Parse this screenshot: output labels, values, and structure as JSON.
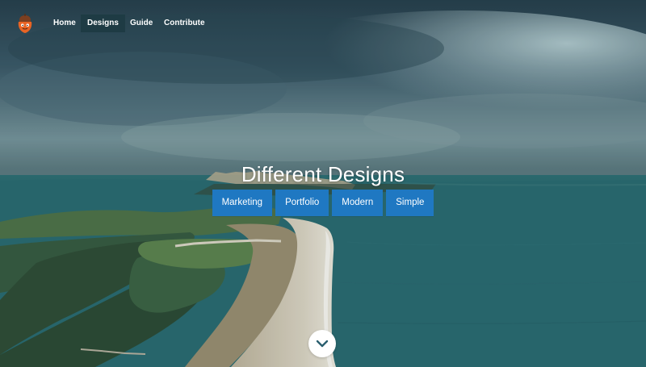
{
  "nav": {
    "logo": "acorn-logo-icon",
    "items": [
      {
        "label": "Home",
        "active": false
      },
      {
        "label": "Designs",
        "active": true
      },
      {
        "label": "Guide",
        "active": false
      },
      {
        "label": "Contribute",
        "active": false
      }
    ]
  },
  "hero": {
    "title": "Different Designs",
    "buttons": [
      "Marketing",
      "Portfolio",
      "Modern",
      "Simple"
    ],
    "scroll_icon": "chevron-down-icon"
  },
  "colors": {
    "accent": "#1f78c2",
    "nav_active": "#1c3a42",
    "text": "#ffffff"
  }
}
